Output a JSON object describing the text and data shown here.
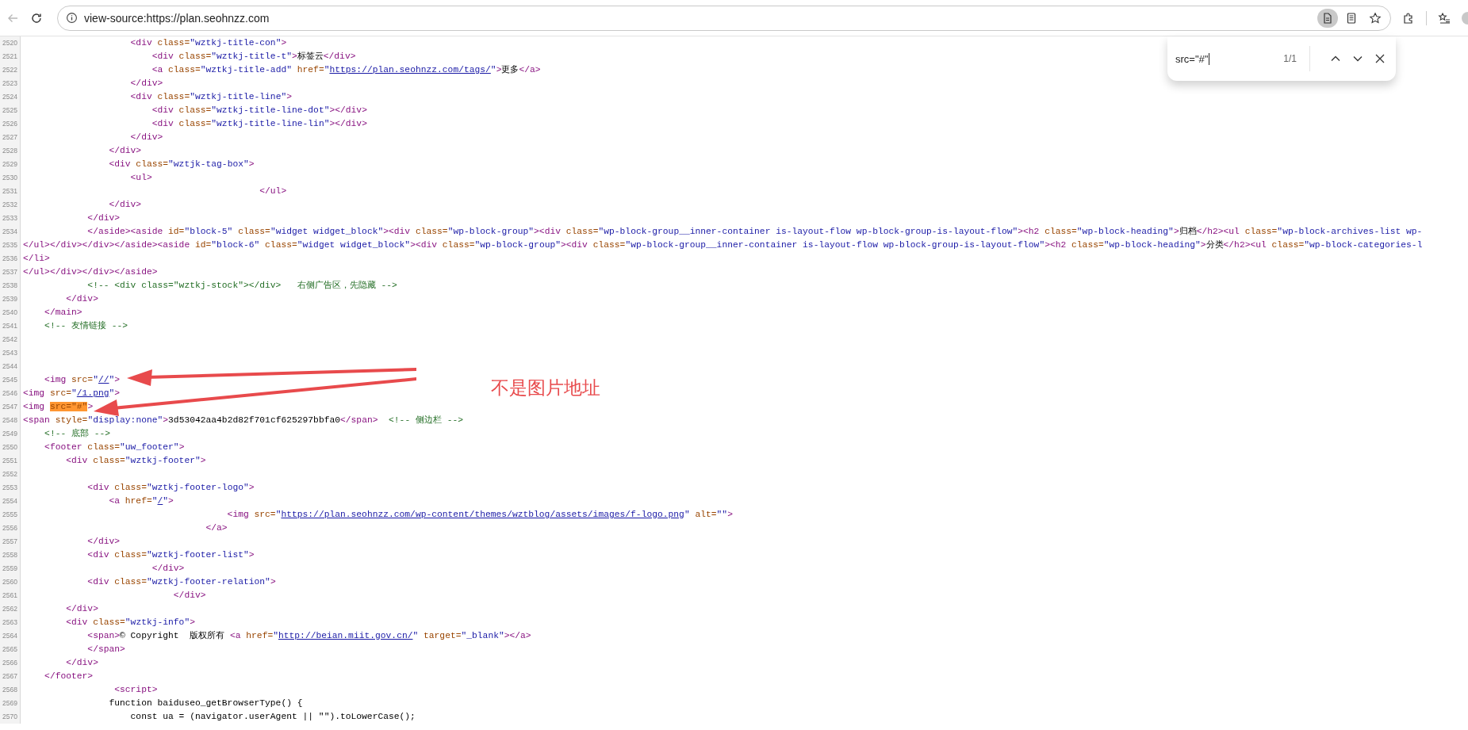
{
  "toolbar": {
    "back_disabled": true,
    "address": "view-source:https://plan.seohnzz.com",
    "page_tools": [
      {
        "kind": "source",
        "active": true
      },
      {
        "kind": "reader",
        "active": false
      },
      {
        "kind": "favorite",
        "active": false
      }
    ]
  },
  "find_bar": {
    "query": "src=\"#\"",
    "count": "1/1"
  },
  "lines": [
    {
      "number": "2520",
      "tokens": [
        {
          "kind": "tag",
          "text": "                    <div"
        },
        {
          "kind": "attr",
          "text": " class="
        },
        {
          "kind": "val",
          "text": "\"wztkj-title-con\""
        },
        {
          "kind": "tag",
          "text": ">"
        }
      ]
    },
    {
      "number": "2521",
      "tokens": [
        {
          "kind": "tag",
          "text": "                        <div"
        },
        {
          "kind": "attr",
          "text": " class="
        },
        {
          "kind": "val",
          "text": "\"wztkj-title-t\""
        },
        {
          "kind": "tag",
          "text": ">"
        },
        {
          "kind": "text",
          "text": "标签云"
        },
        {
          "kind": "tag",
          "text": "</div>"
        }
      ]
    },
    {
      "number": "2522",
      "tokens": [
        {
          "kind": "tag",
          "text": "                        <a"
        },
        {
          "kind": "attr",
          "text": " class="
        },
        {
          "kind": "val",
          "text": "\"wztkj-title-add\""
        },
        {
          "kind": "attr",
          "text": " href="
        },
        {
          "kind": "val",
          "text": "\""
        },
        {
          "kind": "link",
          "text": "https://plan.seohnzz.com/tags/"
        },
        {
          "kind": "val",
          "text": "\""
        },
        {
          "kind": "tag",
          "text": ">"
        },
        {
          "kind": "text",
          "text": "更多"
        },
        {
          "kind": "tag",
          "text": "</a>"
        }
      ]
    },
    {
      "number": "2523",
      "tokens": [
        {
          "kind": "tag",
          "text": "                    </div>"
        }
      ]
    },
    {
      "number": "2524",
      "tokens": [
        {
          "kind": "tag",
          "text": "                    <div"
        },
        {
          "kind": "attr",
          "text": " class="
        },
        {
          "kind": "val",
          "text": "\"wztkj-title-line\""
        },
        {
          "kind": "tag",
          "text": ">"
        }
      ]
    },
    {
      "number": "2525",
      "tokens": [
        {
          "kind": "tag",
          "text": "                        <div"
        },
        {
          "kind": "attr",
          "text": " class="
        },
        {
          "kind": "val",
          "text": "\"wztkj-title-line-dot\""
        },
        {
          "kind": "tag",
          "text": "></div>"
        }
      ]
    },
    {
      "number": "2526",
      "tokens": [
        {
          "kind": "tag",
          "text": "                        <div"
        },
        {
          "kind": "attr",
          "text": " class="
        },
        {
          "kind": "val",
          "text": "\"wztkj-title-line-lin\""
        },
        {
          "kind": "tag",
          "text": "></div>"
        }
      ]
    },
    {
      "number": "2527",
      "tokens": [
        {
          "kind": "tag",
          "text": "                    </div>"
        }
      ]
    },
    {
      "number": "2528",
      "tokens": [
        {
          "kind": "tag",
          "text": "                </div>"
        }
      ]
    },
    {
      "number": "2529",
      "tokens": [
        {
          "kind": "tag",
          "text": "                <div"
        },
        {
          "kind": "attr",
          "text": " class="
        },
        {
          "kind": "val",
          "text": "\"wztjk-tag-box\""
        },
        {
          "kind": "tag",
          "text": ">"
        }
      ]
    },
    {
      "number": "2530",
      "tokens": [
        {
          "kind": "tag",
          "text": "                    <ul>"
        }
      ]
    },
    {
      "number": "2531",
      "tokens": [
        {
          "kind": "tag",
          "text": "                                            </ul>"
        }
      ]
    },
    {
      "number": "2532",
      "tokens": [
        {
          "kind": "tag",
          "text": "                </div>"
        }
      ]
    },
    {
      "number": "2533",
      "tokens": [
        {
          "kind": "tag",
          "text": "            </div>"
        }
      ]
    },
    {
      "number": "2534",
      "tokens": [
        {
          "kind": "tag",
          "text": "            </aside><aside"
        },
        {
          "kind": "attr",
          "text": " id="
        },
        {
          "kind": "val",
          "text": "\"block-5\""
        },
        {
          "kind": "attr",
          "text": " class="
        },
        {
          "kind": "val",
          "text": "\"widget widget_block\""
        },
        {
          "kind": "tag",
          "text": "><div"
        },
        {
          "kind": "attr",
          "text": " class="
        },
        {
          "kind": "val",
          "text": "\"wp-block-group\""
        },
        {
          "kind": "tag",
          "text": "><div"
        },
        {
          "kind": "attr",
          "text": " class="
        },
        {
          "kind": "val",
          "text": "\"wp-block-group__inner-container is-layout-flow wp-block-group-is-layout-flow\""
        },
        {
          "kind": "tag",
          "text": "><h2"
        },
        {
          "kind": "attr",
          "text": " class="
        },
        {
          "kind": "val",
          "text": "\"wp-block-heading\""
        },
        {
          "kind": "tag",
          "text": ">"
        },
        {
          "kind": "text",
          "text": "归档"
        },
        {
          "kind": "tag",
          "text": "</h2><ul"
        },
        {
          "kind": "attr",
          "text": " class="
        },
        {
          "kind": "val",
          "text": "\"wp-block-archives-list wp-"
        }
      ]
    },
    {
      "number": "2535",
      "tokens": [
        {
          "kind": "tag",
          "text": "</ul></div></div></aside><aside"
        },
        {
          "kind": "attr",
          "text": " id="
        },
        {
          "kind": "val",
          "text": "\"block-6\""
        },
        {
          "kind": "attr",
          "text": " class="
        },
        {
          "kind": "val",
          "text": "\"widget widget_block\""
        },
        {
          "kind": "tag",
          "text": "><div"
        },
        {
          "kind": "attr",
          "text": " class="
        },
        {
          "kind": "val",
          "text": "\"wp-block-group\""
        },
        {
          "kind": "tag",
          "text": "><div"
        },
        {
          "kind": "attr",
          "text": " class="
        },
        {
          "kind": "val",
          "text": "\"wp-block-group__inner-container is-layout-flow wp-block-group-is-layout-flow\""
        },
        {
          "kind": "tag",
          "text": "><h2"
        },
        {
          "kind": "attr",
          "text": " class="
        },
        {
          "kind": "val",
          "text": "\"wp-block-heading\""
        },
        {
          "kind": "tag",
          "text": ">"
        },
        {
          "kind": "text",
          "text": "分类"
        },
        {
          "kind": "tag",
          "text": "</h2><ul"
        },
        {
          "kind": "attr",
          "text": " class="
        },
        {
          "kind": "val",
          "text": "\"wp-block-categories-l"
        }
      ]
    },
    {
      "number": "2536",
      "tokens": [
        {
          "kind": "tag",
          "text": "</li>"
        }
      ]
    },
    {
      "number": "2537",
      "tokens": [
        {
          "kind": "tag",
          "text": "</ul></div></div></aside>"
        }
      ]
    },
    {
      "number": "2538",
      "tokens": [
        {
          "kind": "comment",
          "text": "            <!-- <div class=\"wztkj-stock\"></div>   右侧广告区，先隐藏 -->"
        }
      ]
    },
    {
      "number": "2539",
      "tokens": [
        {
          "kind": "tag",
          "text": "        </div>"
        }
      ]
    },
    {
      "number": "2540",
      "tokens": [
        {
          "kind": "tag",
          "text": "    </main>"
        }
      ]
    },
    {
      "number": "2541",
      "tokens": [
        {
          "kind": "comment",
          "text": "    <!-- 友情链接 -->"
        }
      ]
    },
    {
      "number": "2542"
    },
    {
      "number": "2543"
    },
    {
      "number": "2544"
    },
    {
      "number": "2545",
      "tokens": [
        {
          "kind": "tag",
          "text": "    <img"
        },
        {
          "kind": "attr",
          "text": " src="
        },
        {
          "kind": "val",
          "text": "\""
        },
        {
          "kind": "link",
          "text": "//"
        },
        {
          "kind": "val",
          "text": "\""
        },
        {
          "kind": "tag",
          "text": ">"
        }
      ]
    },
    {
      "number": "2546",
      "tokens": [
        {
          "kind": "tag",
          "text": "<img"
        },
        {
          "kind": "attr",
          "text": " src="
        },
        {
          "kind": "val",
          "text": "\""
        },
        {
          "kind": "link",
          "text": "/1.png"
        },
        {
          "kind": "val",
          "text": "\""
        },
        {
          "kind": "tag",
          "text": ">"
        }
      ]
    },
    {
      "number": "2547",
      "tokens": [
        {
          "kind": "tag",
          "text": "<img "
        },
        {
          "kind": "match",
          "text": "src=\"#\""
        },
        {
          "kind": "tag",
          "text": ">"
        }
      ]
    },
    {
      "number": "2548",
      "tokens": [
        {
          "kind": "tag",
          "text": "<span"
        },
        {
          "kind": "attr",
          "text": " style="
        },
        {
          "kind": "val",
          "text": "\"display:none\""
        },
        {
          "kind": "tag",
          "text": ">"
        },
        {
          "kind": "text",
          "text": "3d53042aa4b2d82f701cf625297bbfa0"
        },
        {
          "kind": "tag",
          "text": "</span>"
        },
        {
          "kind": "comment",
          "text": "  <!-- 侧边栏 -->"
        }
      ]
    },
    {
      "number": "2549",
      "tokens": [
        {
          "kind": "comment",
          "text": "    <!-- 底部 -->"
        }
      ]
    },
    {
      "number": "2550",
      "tokens": [
        {
          "kind": "tag",
          "text": "    <footer"
        },
        {
          "kind": "attr",
          "text": " class="
        },
        {
          "kind": "val",
          "text": "\"uw_footer\""
        },
        {
          "kind": "tag",
          "text": ">"
        }
      ]
    },
    {
      "number": "2551",
      "tokens": [
        {
          "kind": "tag",
          "text": "        <div"
        },
        {
          "kind": "attr",
          "text": " class="
        },
        {
          "kind": "val",
          "text": "\"wztkj-footer\""
        },
        {
          "kind": "tag",
          "text": ">"
        }
      ]
    },
    {
      "number": "2552"
    },
    {
      "number": "2553",
      "tokens": [
        {
          "kind": "tag",
          "text": "            <div"
        },
        {
          "kind": "attr",
          "text": " class="
        },
        {
          "kind": "val",
          "text": "\"wztkj-footer-logo\""
        },
        {
          "kind": "tag",
          "text": ">"
        }
      ]
    },
    {
      "number": "2554",
      "tokens": [
        {
          "kind": "tag",
          "text": "                <a"
        },
        {
          "kind": "attr",
          "text": " href="
        },
        {
          "kind": "val",
          "text": "\""
        },
        {
          "kind": "link",
          "text": "/"
        },
        {
          "kind": "val",
          "text": "\""
        },
        {
          "kind": "tag",
          "text": ">"
        }
      ]
    },
    {
      "number": "2555",
      "tokens": [
        {
          "kind": "tag",
          "text": "                                      <img"
        },
        {
          "kind": "attr",
          "text": " src="
        },
        {
          "kind": "val",
          "text": "\""
        },
        {
          "kind": "link",
          "text": "https://plan.seohnzz.com/wp-content/themes/wztblog/assets/images/f-logo.png"
        },
        {
          "kind": "val",
          "text": "\""
        },
        {
          "kind": "attr",
          "text": " alt="
        },
        {
          "kind": "val",
          "text": "\"\""
        },
        {
          "kind": "tag",
          "text": ">"
        }
      ]
    },
    {
      "number": "2556",
      "tokens": [
        {
          "kind": "tag",
          "text": "                                  </a>"
        }
      ]
    },
    {
      "number": "2557",
      "tokens": [
        {
          "kind": "tag",
          "text": "            </div>"
        }
      ]
    },
    {
      "number": "2558",
      "tokens": [
        {
          "kind": "tag",
          "text": "            <div"
        },
        {
          "kind": "attr",
          "text": " class="
        },
        {
          "kind": "val",
          "text": "\"wztkj-footer-list\""
        },
        {
          "kind": "tag",
          "text": ">"
        }
      ]
    },
    {
      "number": "2559",
      "tokens": [
        {
          "kind": "tag",
          "text": "                        </div>"
        }
      ]
    },
    {
      "number": "2560",
      "tokens": [
        {
          "kind": "tag",
          "text": "            <div"
        },
        {
          "kind": "attr",
          "text": " class="
        },
        {
          "kind": "val",
          "text": "\"wztkj-footer-relation\""
        },
        {
          "kind": "tag",
          "text": ">"
        }
      ]
    },
    {
      "number": "2561",
      "tokens": [
        {
          "kind": "tag",
          "text": "                            </div>"
        }
      ]
    },
    {
      "number": "2562",
      "tokens": [
        {
          "kind": "tag",
          "text": "        </div>"
        }
      ]
    },
    {
      "number": "2563",
      "tokens": [
        {
          "kind": "tag",
          "text": "        <div"
        },
        {
          "kind": "attr",
          "text": " class="
        },
        {
          "kind": "val",
          "text": "\"wztkj-info\""
        },
        {
          "kind": "tag",
          "text": ">"
        }
      ]
    },
    {
      "number": "2564",
      "tokens": [
        {
          "kind": "tag",
          "text": "            <span>"
        },
        {
          "kind": "text",
          "text": "© Copyright  版权所有 "
        },
        {
          "kind": "tag",
          "text": "<a"
        },
        {
          "kind": "attr",
          "text": " href="
        },
        {
          "kind": "val",
          "text": "\""
        },
        {
          "kind": "link",
          "text": "http://beian.miit.gov.cn/"
        },
        {
          "kind": "val",
          "text": "\""
        },
        {
          "kind": "attr",
          "text": " target="
        },
        {
          "kind": "val",
          "text": "\"_blank\""
        },
        {
          "kind": "tag",
          "text": "></a>"
        }
      ]
    },
    {
      "number": "2565",
      "tokens": [
        {
          "kind": "tag",
          "text": "            </span>"
        }
      ]
    },
    {
      "number": "2566",
      "tokens": [
        {
          "kind": "tag",
          "text": "        </div>"
        }
      ]
    },
    {
      "number": "2567",
      "tokens": [
        {
          "kind": "tag",
          "text": "    </footer>"
        }
      ]
    },
    {
      "number": "2568",
      "tokens": [
        {
          "kind": "tag",
          "text": "                 <script>"
        }
      ]
    },
    {
      "number": "2569",
      "tokens": [
        {
          "kind": "text",
          "text": "                function baiduseo_getBrowserType() {"
        }
      ]
    },
    {
      "number": "2570",
      "tokens": [
        {
          "kind": "text",
          "text": "                    const ua = (navigator.userAgent || \"\").toLowerCase();"
        }
      ]
    }
  ],
  "annotation": {
    "text": "不是图片地址"
  }
}
